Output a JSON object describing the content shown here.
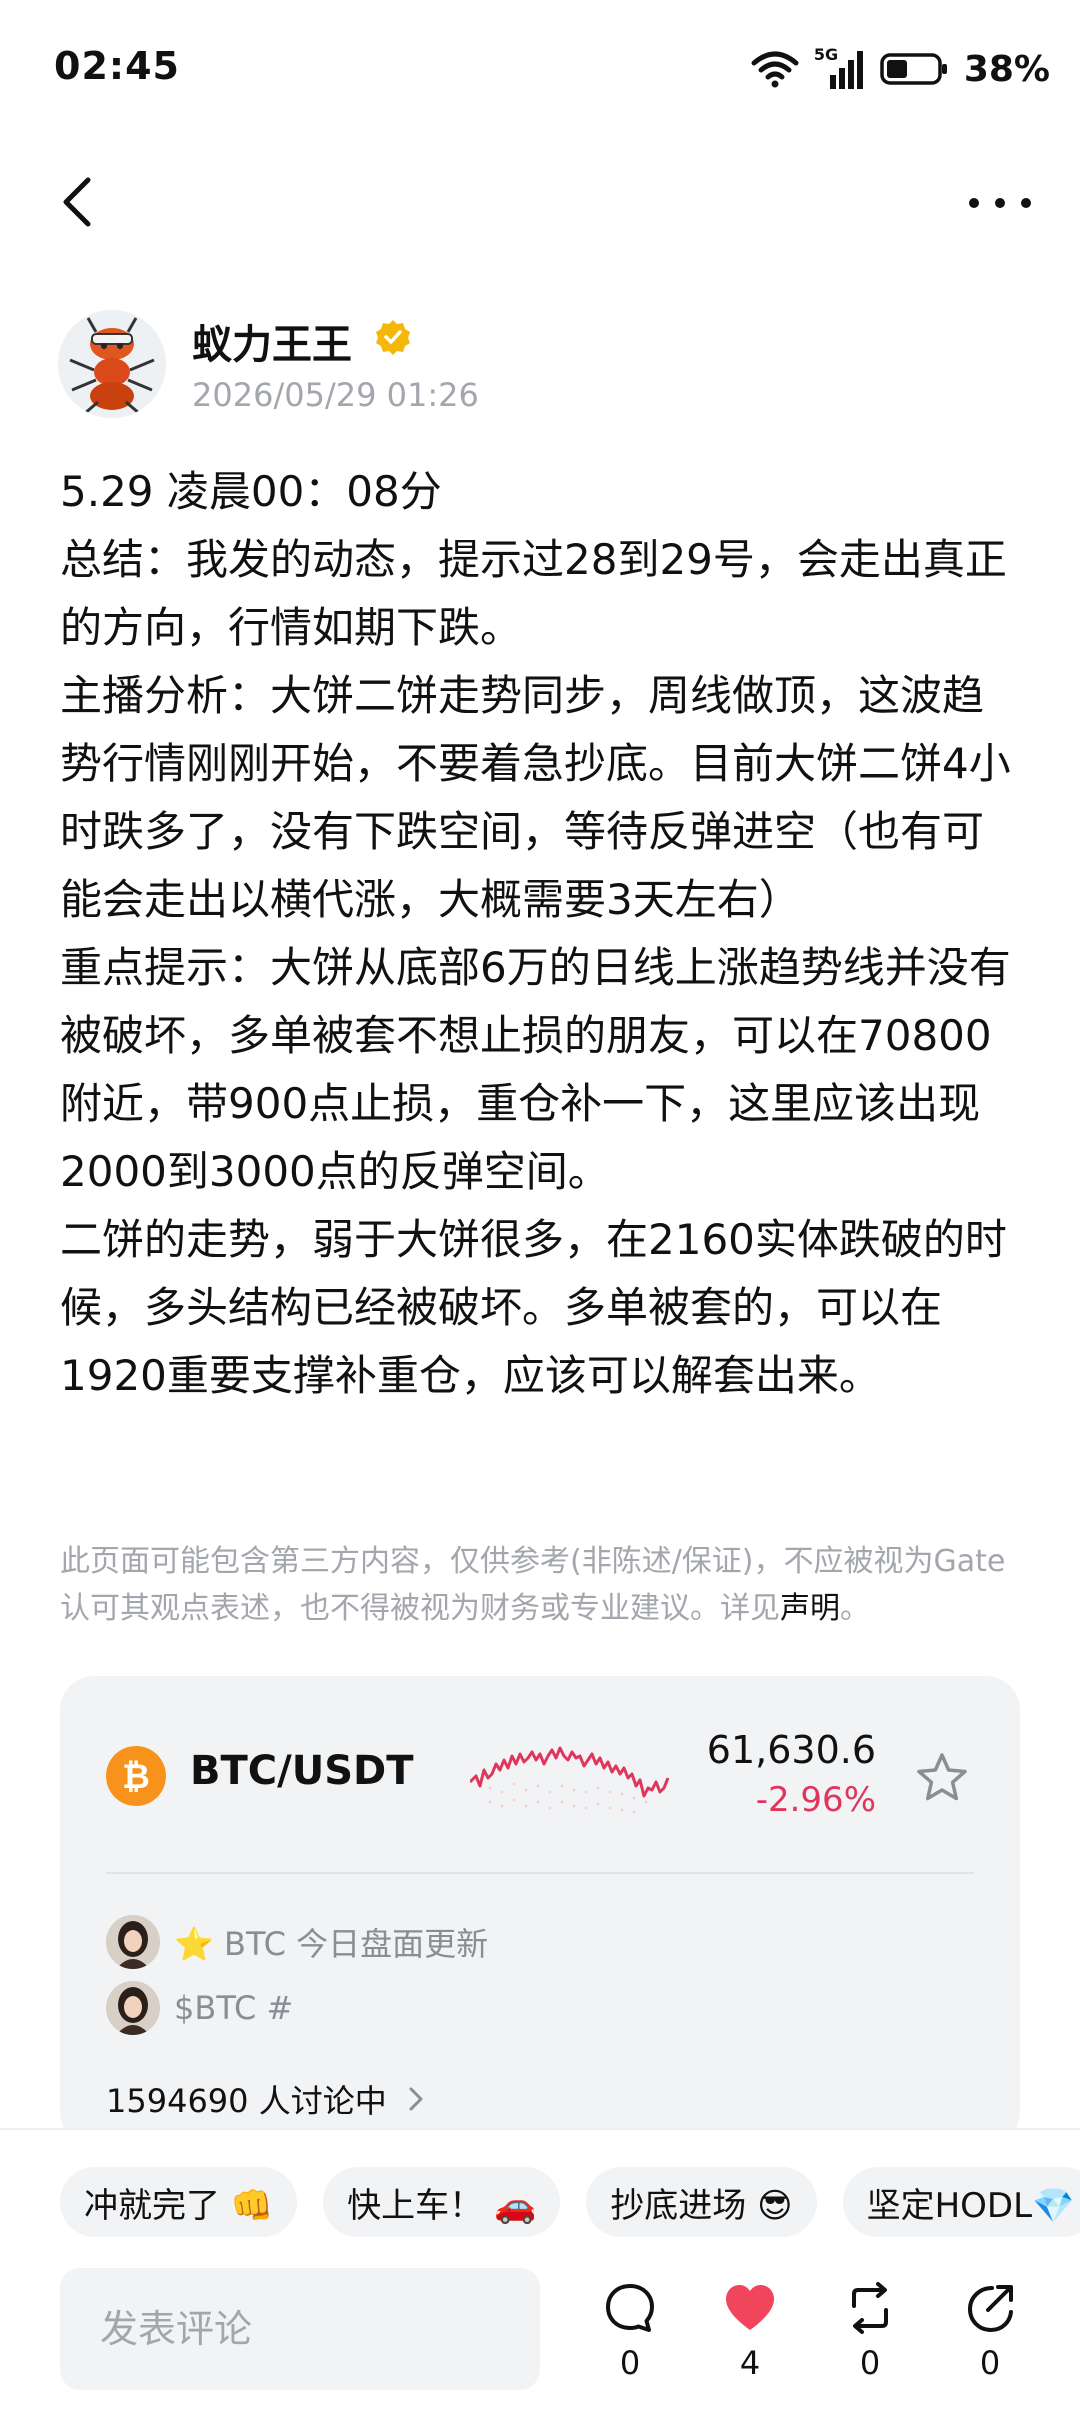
{
  "status_bar": {
    "time": "02:45",
    "network": "5G",
    "battery": "38%"
  },
  "author": {
    "name": "蚁力王王",
    "time": "2026/05/29 01:26",
    "avatar_icon": "ant-mascot-icon",
    "verified_icon": "verified-badge-icon"
  },
  "post": {
    "lines": [
      "5.29  凌晨00：08分",
      "总结：我发的动态，提示过28到29号，会走出真正的方向，行情如期下跌。",
      "主播分析：大饼二饼走势同步，周线做顶，这波趋势行情刚刚开始，不要着急抄底。目前大饼二饼4小时跌多了，没有下跌空间，等待反弹进空（也有可能会走出以横代涨，大概需要3天左右）",
      "重点提示：大饼从底部6万的日线上涨趋势线并没有被破坏，多单被套不想止损的朋友，可以在70800附近，带900点止损，重仓补一下，这里应该出现2000到3000点的反弹空间。",
      "二饼的走势，弱于大饼很多，在2160实体跌破的时候，多头结构已经被破坏。多单被套的，可以在1920重要支撑补重仓，应该可以解套出来。"
    ]
  },
  "disclaimer": {
    "text": "此页面可能包含第三方内容，仅供参考(非陈述/保证)，不应被视为Gate认可其观点表述，也不得被视为财务或专业建议。详见",
    "link": "声明",
    "suffix": "。"
  },
  "market_card": {
    "pair": "BTC/USDT",
    "price": "61,630.6",
    "change": "-2.96%",
    "change_color": "#e0365c",
    "coin_icon": "bitcoin-icon",
    "topics": [
      {
        "text": "⭐ BTC 今日盘面更新"
      },
      {
        "text": "$BTC #"
      }
    ],
    "discuss": "1594690 人讨论中"
  },
  "chips": [
    "冲就完了 👊",
    "快上车！ 🚗",
    "抄底进场 😎",
    "坚定HODL💎"
  ],
  "comment": {
    "placeholder": "发表评论"
  },
  "actions": {
    "comment_count": "0",
    "like_count": "4",
    "repost_count": "0",
    "share_count": "0",
    "like_color": "#f0455b"
  }
}
